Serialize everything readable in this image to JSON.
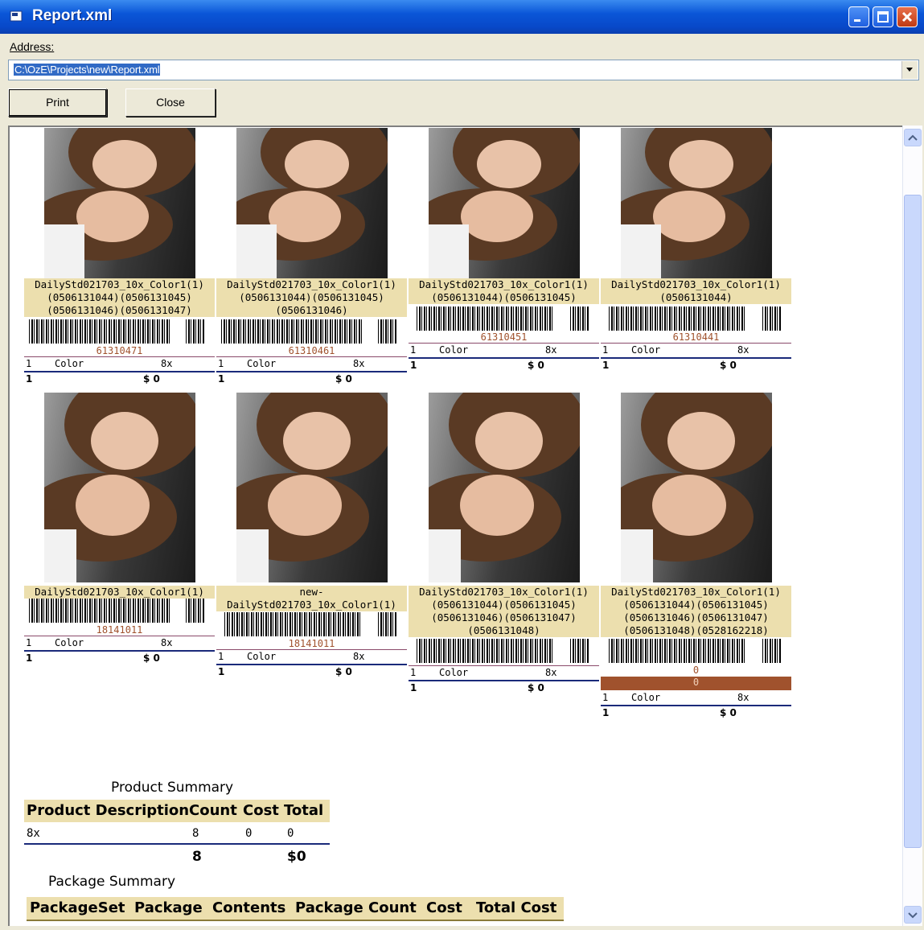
{
  "window": {
    "title": "Report.xml",
    "address_label": "Address:",
    "address_value": "C:\\OzE\\Projects\\new\\Report.xml",
    "buttons": {
      "print": "Print",
      "close": "Close"
    }
  },
  "cards": [
    {
      "caption": [
        "DailyStd021703_10x_Color1(1)",
        "(0506131044)(0506131045)",
        "(0506131046)(0506131047)"
      ],
      "barcode": "61310471",
      "qty": "1",
      "item": "Color",
      "size": "8x",
      "count": "1",
      "cost": "$ 0"
    },
    {
      "caption": [
        "DailyStd021703_10x_Color1(1)",
        "(0506131044)(0506131045)",
        "(0506131046)"
      ],
      "barcode": "61310461",
      "qty": "1",
      "item": "Color",
      "size": "8x",
      "count": "1",
      "cost": "$ 0"
    },
    {
      "caption": [
        "DailyStd021703_10x_Color1(1)",
        "(0506131044)(0506131045)"
      ],
      "barcode": "61310451",
      "qty": "1",
      "item": "Color",
      "size": "8x",
      "count": "1",
      "cost": "$ 0"
    },
    {
      "caption": [
        "DailyStd021703_10x_Color1(1)",
        "(0506131044)"
      ],
      "barcode": "61310441",
      "qty": "1",
      "item": "Color",
      "size": "8x",
      "count": "1",
      "cost": "$ 0"
    },
    {
      "caption": [
        "DailyStd021703_10x_Color1(1)"
      ],
      "barcode": "18141011",
      "qty": "1",
      "item": "Color",
      "size": "8x",
      "count": "1",
      "cost": "$ 0"
    },
    {
      "caption": [
        "new-",
        "DailyStd021703_10x_Color1(1)"
      ],
      "barcode": "18141011",
      "qty": "1",
      "item": "Color",
      "size": "8x",
      "count": "1",
      "cost": "$ 0"
    },
    {
      "caption": [
        "DailyStd021703_10x_Color1(1)",
        "(0506131044)(0506131045)",
        "(0506131046)(0506131047)",
        "(0506131048)"
      ],
      "barcode": "",
      "qty": "1",
      "item": "Color",
      "size": "8x",
      "count": "1",
      "cost": "$ 0"
    },
    {
      "caption": [
        "DailyStd021703_10x_Color1(1)",
        "(0506131044)(0506131045)",
        "(0506131046)(0506131047)",
        "(0506131048)(0528162218)"
      ],
      "barcode": "0",
      "barcode2": "0",
      "qty": "1",
      "item": "Color",
      "size": "8x",
      "count": "1",
      "cost": "$ 0"
    }
  ],
  "product_summary": {
    "title": "Product Summary",
    "headers": [
      "Product Description",
      "Count",
      "Cost",
      "Total"
    ],
    "rows": [
      {
        "description": "8x",
        "count": "8",
        "cost": "0",
        "total": "0"
      }
    ],
    "totals": {
      "count": "8",
      "total": "$0"
    }
  },
  "package_summary": {
    "title": "Package Summary",
    "headers": [
      "PackageSet",
      "Package",
      "Contents",
      "Package Count",
      "Cost",
      "Total Cost"
    ]
  },
  "colors": {
    "caption_bg": "#ecdfae",
    "rule": "#1a2a7a",
    "barcode_num": "#a0522d",
    "highlight_bar": "#a0522d"
  }
}
